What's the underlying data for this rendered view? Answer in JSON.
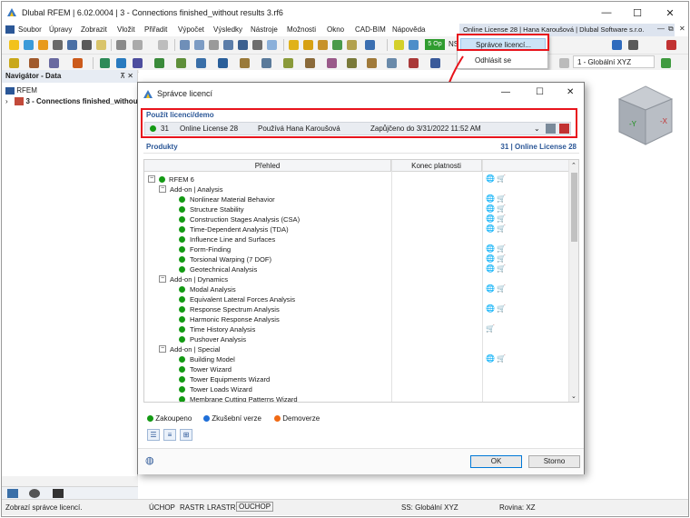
{
  "window": {
    "title": "Dlubal RFEM | 6.02.0004 | 3 - Connections finished_without results 3.rf6",
    "controls": {
      "minimize": "—",
      "maximize": "☐",
      "close": "✕"
    }
  },
  "menu": {
    "items": [
      "Soubor",
      "Úpravy",
      "Zobrazit",
      "Vložit",
      "Přiřadit",
      "Výpočet",
      "Výsledky",
      "Nástroje",
      "Možnosti",
      "Okno",
      "CAD-BIM",
      "Nápověda"
    ],
    "user_strip": "Online License 28 | Hana Karoušová | Dlubal Software s.r.o.",
    "mdi_controls": [
      "—",
      "⧉",
      "✕"
    ]
  },
  "toolbar": {
    "badge_5op": "5 Op",
    "ns_label": "NS",
    "coord_system": "1 - Globální XYZ"
  },
  "license_dropdown": {
    "items": [
      "Správce licencí...",
      "Odhlásit se"
    ]
  },
  "navigator": {
    "title": "Navigátor - Data",
    "pin": "⊼ ✕",
    "root": "RFEM",
    "model": "3 - Connections finished_without"
  },
  "status": {
    "message": "Zobrazí správce licencí.",
    "toggles": [
      "ÚCHOP",
      "RASTR",
      "LRASTR",
      "OUCHOP"
    ],
    "ss": "SS: Globální XYZ",
    "plane": "Rovina: XZ"
  },
  "dialog": {
    "title": "Správce licencí",
    "controls": {
      "minimize": "—",
      "maximize": "☐",
      "close": "✕"
    },
    "use_license_label": "Použít licenci/demo",
    "license": {
      "number": "31",
      "name": "Online License 28",
      "user": "Používá Hana Karoušová",
      "borrowed": "Zapůjčeno do 3/31/2022 11:52 AM"
    },
    "products_label": "Produkty",
    "products_right": "31 | Online License 28",
    "columns": {
      "overview": "Přehled",
      "expiry": "Konec platnosti"
    },
    "tree": [
      {
        "type": "product",
        "label": "RFEM 6",
        "level": 0,
        "expander": "−",
        "dot": "green",
        "icons": "🌐 🛒"
      },
      {
        "type": "group",
        "label": "Add-on | Analysis",
        "level": 1,
        "expander": "−"
      },
      {
        "type": "item",
        "label": "Nonlinear Material Behavior",
        "level": 2,
        "dot": "green",
        "icons": "🌐 🛒"
      },
      {
        "type": "item",
        "label": "Structure Stability",
        "level": 2,
        "dot": "green",
        "icons": "🌐 🛒"
      },
      {
        "type": "item",
        "label": "Construction Stages Analysis (CSA)",
        "level": 2,
        "dot": "green",
        "icons": "🌐 🛒"
      },
      {
        "type": "item",
        "label": "Time-Dependent Analysis (TDA)",
        "level": 2,
        "dot": "green",
        "icons": "🌐 🛒"
      },
      {
        "type": "item",
        "label": "Influence Line and Surfaces",
        "level": 2,
        "dot": "green",
        "icons": ""
      },
      {
        "type": "item",
        "label": "Form-Finding",
        "level": 2,
        "dot": "green",
        "icons": "🌐 🛒"
      },
      {
        "type": "item",
        "label": "Torsional Warping (7 DOF)",
        "level": 2,
        "dot": "green",
        "icons": "🌐 🛒"
      },
      {
        "type": "item",
        "label": "Geotechnical Analysis",
        "level": 2,
        "dot": "green",
        "icons": "🌐 🛒"
      },
      {
        "type": "group",
        "label": "Add-on | Dynamics",
        "level": 1,
        "expander": "−"
      },
      {
        "type": "item",
        "label": "Modal Analysis",
        "level": 2,
        "dot": "green",
        "icons": "🌐 🛒"
      },
      {
        "type": "item",
        "label": "Equivalent Lateral Forces Analysis",
        "level": 2,
        "dot": "green",
        "icons": ""
      },
      {
        "type": "item",
        "label": "Response Spectrum Analysis",
        "level": 2,
        "dot": "green",
        "icons": "🌐 🛒"
      },
      {
        "type": "item",
        "label": "Harmonic Response Analysis",
        "level": 2,
        "dot": "green",
        "icons": ""
      },
      {
        "type": "item",
        "label": "Time History Analysis",
        "level": 2,
        "dot": "green",
        "icons": "🛒"
      },
      {
        "type": "item",
        "label": "Pushover Analysis",
        "level": 2,
        "dot": "green",
        "icons": ""
      },
      {
        "type": "group",
        "label": "Add-on | Special",
        "level": 1,
        "expander": "−"
      },
      {
        "type": "item",
        "label": "Building Model",
        "level": 2,
        "dot": "green",
        "icons": "🌐 🛒"
      },
      {
        "type": "item",
        "label": "Tower Wizard",
        "level": 2,
        "dot": "green",
        "icons": ""
      },
      {
        "type": "item",
        "label": "Tower Equipments Wizard",
        "level": 2,
        "dot": "green",
        "icons": ""
      },
      {
        "type": "item",
        "label": "Tower Loads Wizard",
        "level": 2,
        "dot": "green",
        "icons": ""
      },
      {
        "type": "item",
        "label": "Membrane Cutting Patterns Wizard",
        "level": 2,
        "dot": "green",
        "icons": ""
      }
    ],
    "legend": {
      "purchased": "Zakoupeno",
      "trial": "Zkušební verze",
      "demo": "Demoverze"
    },
    "buttons": {
      "ok": "OK",
      "cancel": "Storno"
    }
  },
  "colors": {
    "highlight_red": "#e8141c",
    "accent_blue": "#2b5797",
    "purchased_green": "#149a14",
    "trial_blue": "#1f6fd8",
    "demo_orange": "#f06a14"
  }
}
